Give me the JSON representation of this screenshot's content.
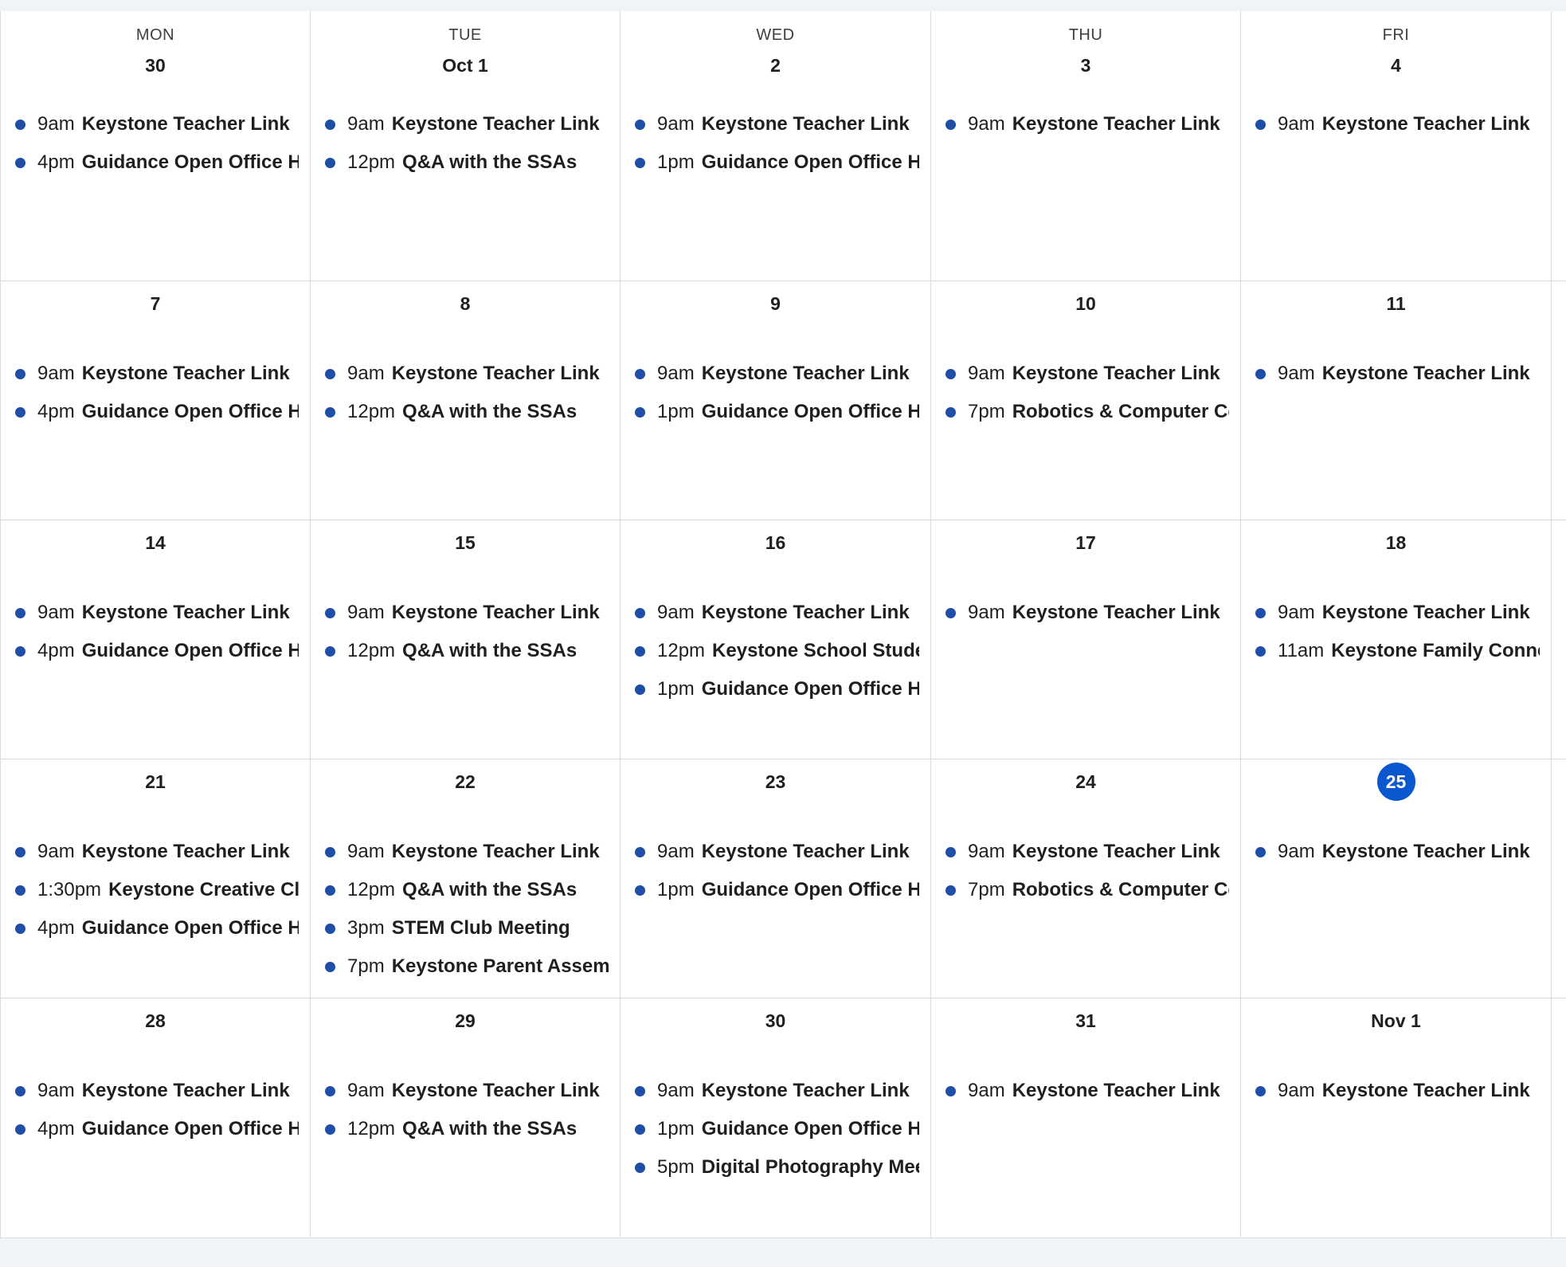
{
  "colors": {
    "background": "#f0f4f9",
    "grid_line": "#dadce0",
    "event_dot": "#1e4ea8",
    "today_highlight": "#0b57d0"
  },
  "calendar": {
    "weekdays": [
      "MON",
      "TUE",
      "WED",
      "THU",
      "FRI"
    ],
    "weeks": [
      {
        "days": [
          {
            "label": "30",
            "events": [
              {
                "time": "9am",
                "title": "Keystone Teacher Link"
              },
              {
                "time": "4pm",
                "title": "Guidance Open Office H"
              }
            ]
          },
          {
            "label": "Oct 1",
            "events": [
              {
                "time": "9am",
                "title": "Keystone Teacher Link"
              },
              {
                "time": "12pm",
                "title": "Q&A with the SSAs"
              }
            ]
          },
          {
            "label": "2",
            "events": [
              {
                "time": "9am",
                "title": "Keystone Teacher Link"
              },
              {
                "time": "1pm",
                "title": "Guidance Open Office H"
              }
            ]
          },
          {
            "label": "3",
            "events": [
              {
                "time": "9am",
                "title": "Keystone Teacher Link"
              }
            ]
          },
          {
            "label": "4",
            "events": [
              {
                "time": "9am",
                "title": "Keystone Teacher Link"
              }
            ]
          }
        ]
      },
      {
        "days": [
          {
            "label": "7",
            "events": [
              {
                "time": "9am",
                "title": "Keystone Teacher Link"
              },
              {
                "time": "4pm",
                "title": "Guidance Open Office H"
              }
            ]
          },
          {
            "label": "8",
            "events": [
              {
                "time": "9am",
                "title": "Keystone Teacher Link"
              },
              {
                "time": "12pm",
                "title": "Q&A with the SSAs"
              }
            ]
          },
          {
            "label": "9",
            "events": [
              {
                "time": "9am",
                "title": "Keystone Teacher Link"
              },
              {
                "time": "1pm",
                "title": "Guidance Open Office H"
              }
            ]
          },
          {
            "label": "10",
            "events": [
              {
                "time": "9am",
                "title": "Keystone Teacher Link"
              },
              {
                "time": "7pm",
                "title": "Robotics & Computer Cc"
              }
            ]
          },
          {
            "label": "11",
            "events": [
              {
                "time": "9am",
                "title": "Keystone Teacher Link"
              }
            ]
          }
        ]
      },
      {
        "days": [
          {
            "label": "14",
            "events": [
              {
                "time": "9am",
                "title": "Keystone Teacher Link"
              },
              {
                "time": "4pm",
                "title": "Guidance Open Office H"
              }
            ]
          },
          {
            "label": "15",
            "events": [
              {
                "time": "9am",
                "title": "Keystone Teacher Link"
              },
              {
                "time": "12pm",
                "title": "Q&A with the SSAs"
              }
            ]
          },
          {
            "label": "16",
            "events": [
              {
                "time": "9am",
                "title": "Keystone Teacher Link"
              },
              {
                "time": "12pm",
                "title": "Keystone School Studer"
              },
              {
                "time": "1pm",
                "title": "Guidance Open Office H"
              }
            ]
          },
          {
            "label": "17",
            "events": [
              {
                "time": "9am",
                "title": "Keystone Teacher Link"
              }
            ]
          },
          {
            "label": "18",
            "events": [
              {
                "time": "9am",
                "title": "Keystone Teacher Link"
              },
              {
                "time": "11am",
                "title": "Keystone Family Connec"
              }
            ]
          }
        ]
      },
      {
        "days": [
          {
            "label": "21",
            "events": [
              {
                "time": "9am",
                "title": "Keystone Teacher Link"
              },
              {
                "time": "1:30pm",
                "title": "Keystone Creative Clu"
              },
              {
                "time": "4pm",
                "title": "Guidance Open Office H"
              }
            ]
          },
          {
            "label": "22",
            "events": [
              {
                "time": "9am",
                "title": "Keystone Teacher Link"
              },
              {
                "time": "12pm",
                "title": "Q&A with the SSAs"
              },
              {
                "time": "3pm",
                "title": "STEM Club Meeting"
              },
              {
                "time": "7pm",
                "title": "Keystone Parent Asseml"
              }
            ]
          },
          {
            "label": "23",
            "events": [
              {
                "time": "9am",
                "title": "Keystone Teacher Link"
              },
              {
                "time": "1pm",
                "title": "Guidance Open Office H"
              }
            ]
          },
          {
            "label": "24",
            "events": [
              {
                "time": "9am",
                "title": "Keystone Teacher Link"
              },
              {
                "time": "7pm",
                "title": "Robotics & Computer Cc"
              }
            ]
          },
          {
            "label": "25",
            "today": true,
            "events": [
              {
                "time": "9am",
                "title": "Keystone Teacher Link"
              }
            ]
          }
        ]
      },
      {
        "days": [
          {
            "label": "28",
            "events": [
              {
                "time": "9am",
                "title": "Keystone Teacher Link"
              },
              {
                "time": "4pm",
                "title": "Guidance Open Office H"
              }
            ]
          },
          {
            "label": "29",
            "events": [
              {
                "time": "9am",
                "title": "Keystone Teacher Link"
              },
              {
                "time": "12pm",
                "title": "Q&A with the SSAs"
              }
            ]
          },
          {
            "label": "30",
            "events": [
              {
                "time": "9am",
                "title": "Keystone Teacher Link"
              },
              {
                "time": "1pm",
                "title": "Guidance Open Office H"
              },
              {
                "time": "5pm",
                "title": "Digital Photography Mee"
              }
            ]
          },
          {
            "label": "31",
            "events": [
              {
                "time": "9am",
                "title": "Keystone Teacher Link"
              }
            ]
          },
          {
            "label": "Nov 1",
            "events": [
              {
                "time": "9am",
                "title": "Keystone Teacher Link"
              }
            ]
          }
        ]
      }
    ]
  }
}
